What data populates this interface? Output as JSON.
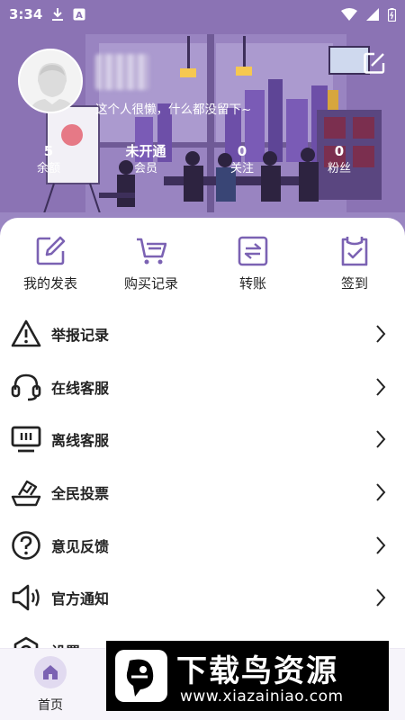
{
  "status_bar": {
    "time": "3:34",
    "left_icons": [
      "download-icon",
      "text-a-icon"
    ],
    "right_icons": [
      "wifi-icon",
      "signal-icon",
      "battery-icon"
    ]
  },
  "profile": {
    "signature": "这个人很懒，什么都没留下~",
    "edit_icon": "edit-icon",
    "stats": [
      {
        "value": "5",
        "label": "余额"
      },
      {
        "value": "未开通",
        "label": "会员"
      },
      {
        "value": "0",
        "label": "关注"
      },
      {
        "value": "0",
        "label": "粉丝"
      }
    ]
  },
  "quick_actions": [
    {
      "label": "我的发表",
      "icon": "pencil-square-icon"
    },
    {
      "label": "购买记录",
      "icon": "cart-icon"
    },
    {
      "label": "转账",
      "icon": "transfer-icon"
    },
    {
      "label": "签到",
      "icon": "checkin-clipboard-icon"
    }
  ],
  "menu": [
    {
      "label": "举报记录",
      "icon": "warning-triangle-icon"
    },
    {
      "label": "在线客服",
      "icon": "headset-icon"
    },
    {
      "label": "离线客服",
      "icon": "monitor-icon"
    },
    {
      "label": "全民投票",
      "icon": "ballot-box-icon"
    },
    {
      "label": "意见反馈",
      "icon": "question-circle-icon"
    },
    {
      "label": "官方通知",
      "icon": "speaker-icon"
    },
    {
      "label": "设置",
      "icon": "settings-icon"
    }
  ],
  "bottom_nav": {
    "home_label": "首页"
  },
  "watermark": {
    "title": "下载鸟资源",
    "url": "www.xiazainiao.com"
  },
  "colors": {
    "accent": "#7b62b3",
    "header_purple": "#8d76b5",
    "text": "#222222"
  }
}
